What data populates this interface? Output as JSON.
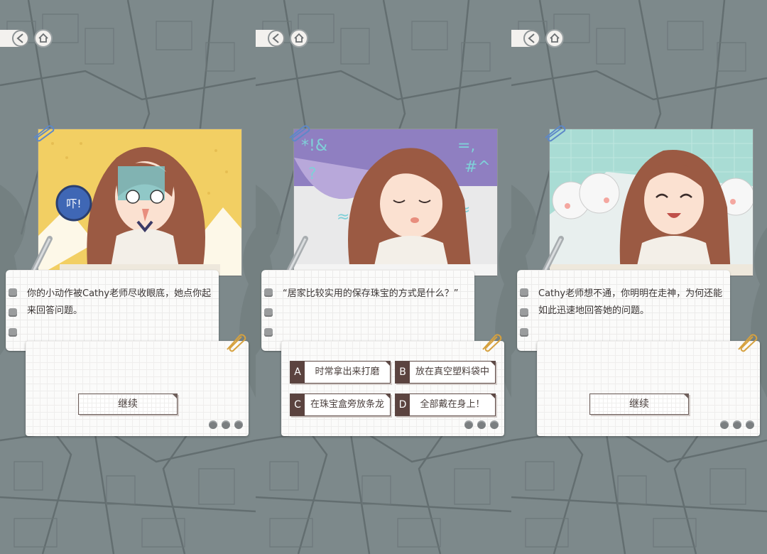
{
  "screens": [
    {
      "dialog_text": "你的小动作被Cathy老师尽收眼底，她点你起来回答问题。",
      "continue_label": "继续",
      "scene_bg": "#f2cf63",
      "bubble_text": "吓!"
    },
    {
      "dialog_text": "“居家比较实用的保存珠宝的方式是什么？”",
      "scene_bg": "#8f7fc1",
      "options": [
        {
          "letter": "A",
          "text": "时常拿出来打磨"
        },
        {
          "letter": "B",
          "text": "放在真空塑料袋中"
        },
        {
          "letter": "C",
          "text": "在珠宝盒旁放条龙"
        },
        {
          "letter": "D",
          "text": "全部戴在身上！"
        }
      ]
    },
    {
      "dialog_text": "Cathy老师想不通，你明明在走神，为何还能如此迅速地回答她的问题。",
      "continue_label": "继续",
      "scene_bg": "#a9dcd4"
    }
  ],
  "colors": {
    "map_bg": "#7d898b",
    "accent_dark": "#5b433f",
    "hair": "#9b5a43"
  }
}
